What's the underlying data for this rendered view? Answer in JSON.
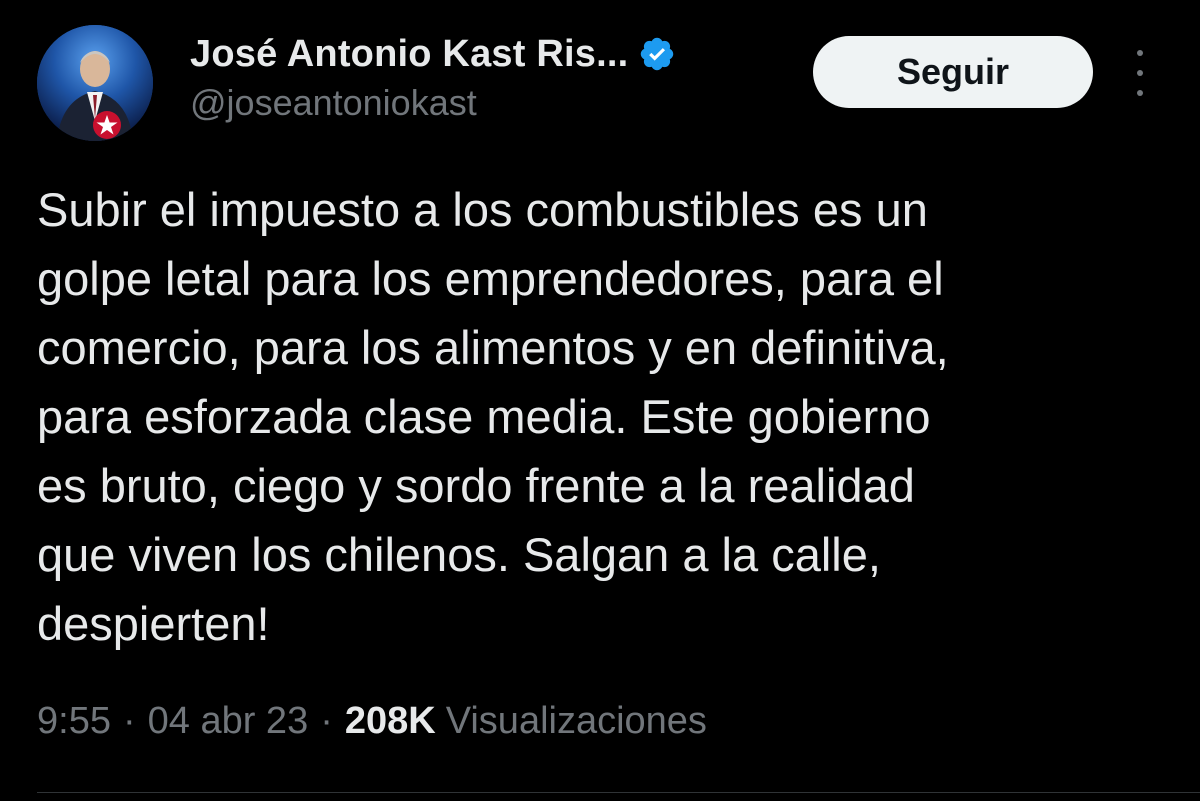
{
  "author": {
    "display_name": "José Antonio Kast Ris...",
    "handle": "@joseantonio‌kast",
    "verified_icon": "verified-badge-icon",
    "avatar_icon": "avatar-photo"
  },
  "actions": {
    "follow_label": "Seguir",
    "more_icon": "more-vertical-icon"
  },
  "tweet": {
    "lines": [
      "Subir el impuesto a los combustibles es un",
      "golpe letal para los emprendedores, para el",
      "comercio, para los alimentos y en definitiva,",
      "para esforzada clase media. Este gobierno",
      "es bruto, ciego y sordo frente a la realidad",
      "que viven los chilenos. Salgan a la calle,",
      "despierten!"
    ]
  },
  "meta": {
    "time": "9:55",
    "separator": "·",
    "date": "04 abr 23",
    "views_count": "208K",
    "views_label": "Visualizaciones"
  },
  "colors": {
    "background": "#000000",
    "text_primary": "#e7e9ea",
    "text_secondary": "#71767b",
    "verified_blue": "#1d9bf0",
    "button_bg": "#eff3f4"
  }
}
